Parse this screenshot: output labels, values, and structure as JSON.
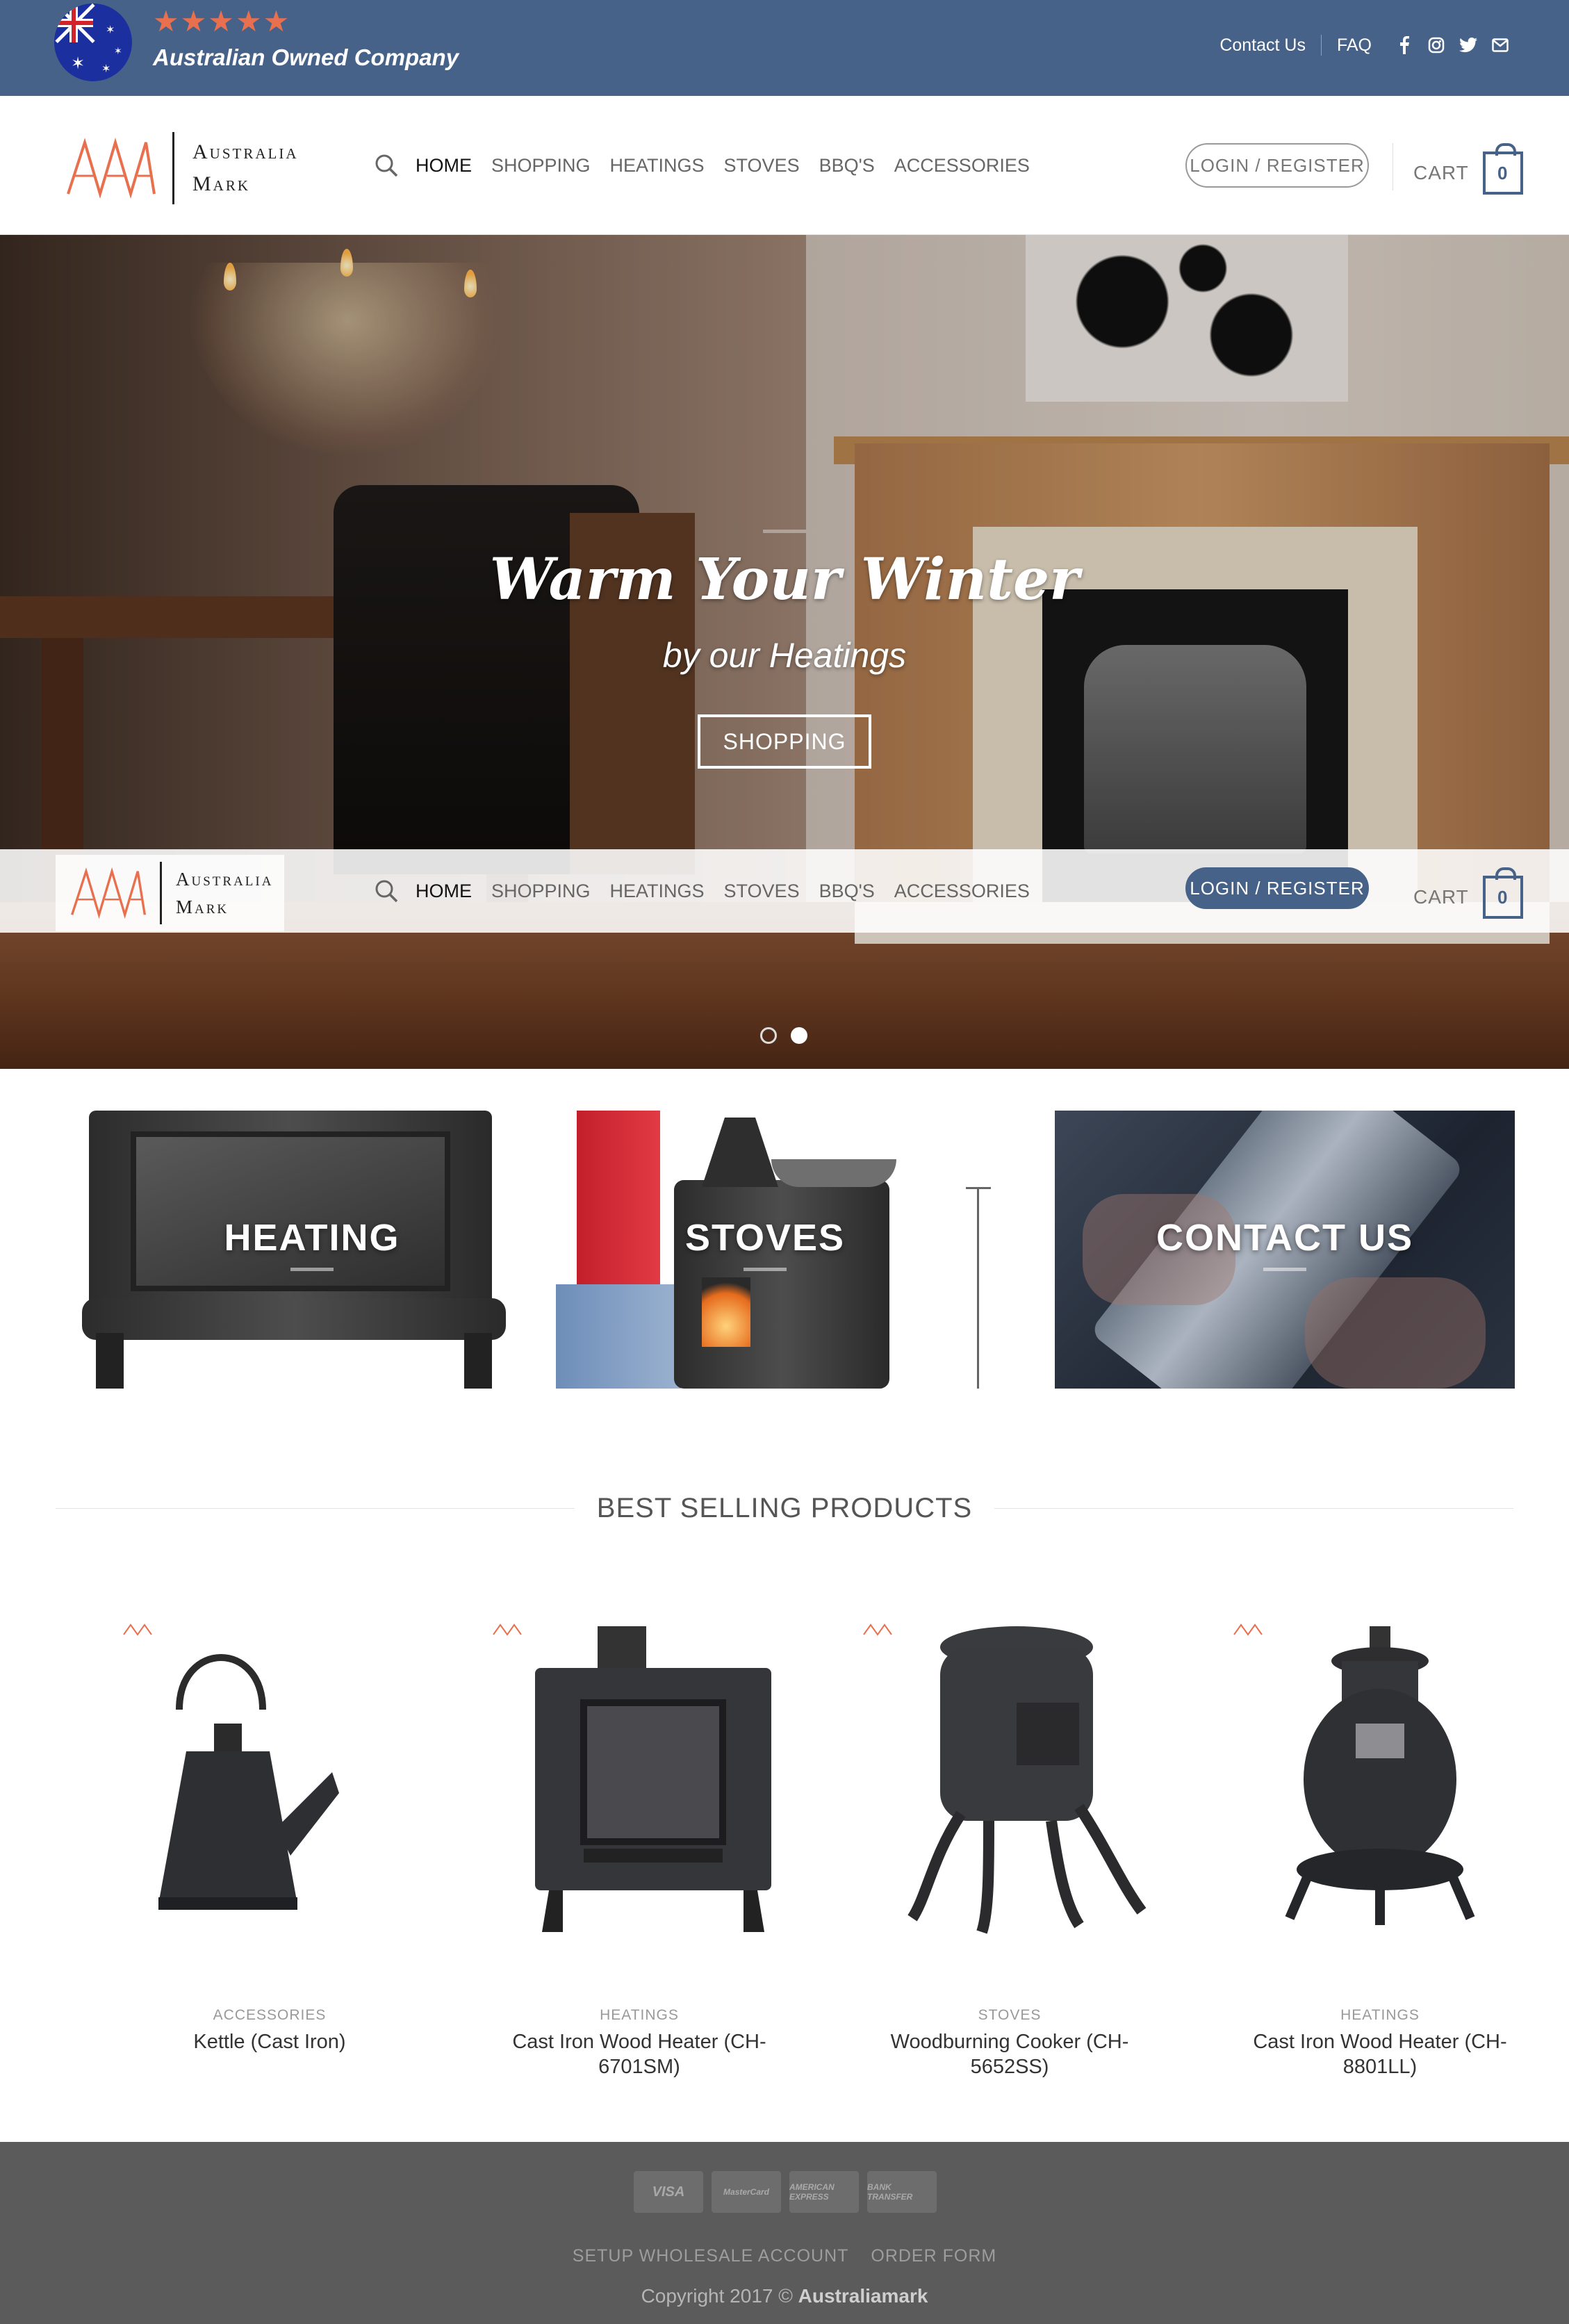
{
  "topbar": {
    "rating_stars": "★★★★★",
    "tagline": "Australian Owned Company",
    "links": [
      "Contact Us",
      "FAQ"
    ],
    "social_icons": [
      "facebook-icon",
      "instagram-icon",
      "twitter-icon",
      "email-icon"
    ],
    "bg_color": "#476289",
    "star_color": "#e8704e"
  },
  "brand": {
    "line1": "Australia",
    "line2": "Mark"
  },
  "nav": {
    "items": [
      "HOME",
      "SHOPPING",
      "HEATINGS",
      "STOVES",
      "BBQ'S",
      "ACCESSORIES"
    ],
    "active": "HOME"
  },
  "account": {
    "login_label": "LOGIN / REGISTER",
    "cart_label": "CART",
    "cart_count": "0"
  },
  "hero": {
    "title": "Warm Your Winter",
    "subtitle": "by our Heatings",
    "cta_label": "SHOPPING",
    "slides": 2,
    "active_slide": 2
  },
  "categories": [
    {
      "label": "HEATING"
    },
    {
      "label": "STOVES"
    },
    {
      "label": "CONTACT US"
    }
  ],
  "best_selling": {
    "title": "BEST SELLING PRODUCTS",
    "products": [
      {
        "category": "ACCESSORIES",
        "name": "Kettle (Cast Iron)"
      },
      {
        "category": "HEATINGS",
        "name": "Cast Iron Wood Heater (CH-6701SM)"
      },
      {
        "category": "STOVES",
        "name": "Woodburning Cooker (CH-5652SS)"
      },
      {
        "category": "HEATINGS",
        "name": "Cast Iron Wood Heater (CH-8801LL)"
      }
    ]
  },
  "footer": {
    "payment_methods": [
      "VISA",
      "MasterCard",
      "AMERICAN EXPRESS",
      "BANK TRANSFER"
    ],
    "links": [
      "SETUP WHOLESALE ACCOUNT",
      "ORDER FORM"
    ],
    "copyright_prefix": "Copyright 2017 © ",
    "copyright_brand": "Australiamark"
  }
}
